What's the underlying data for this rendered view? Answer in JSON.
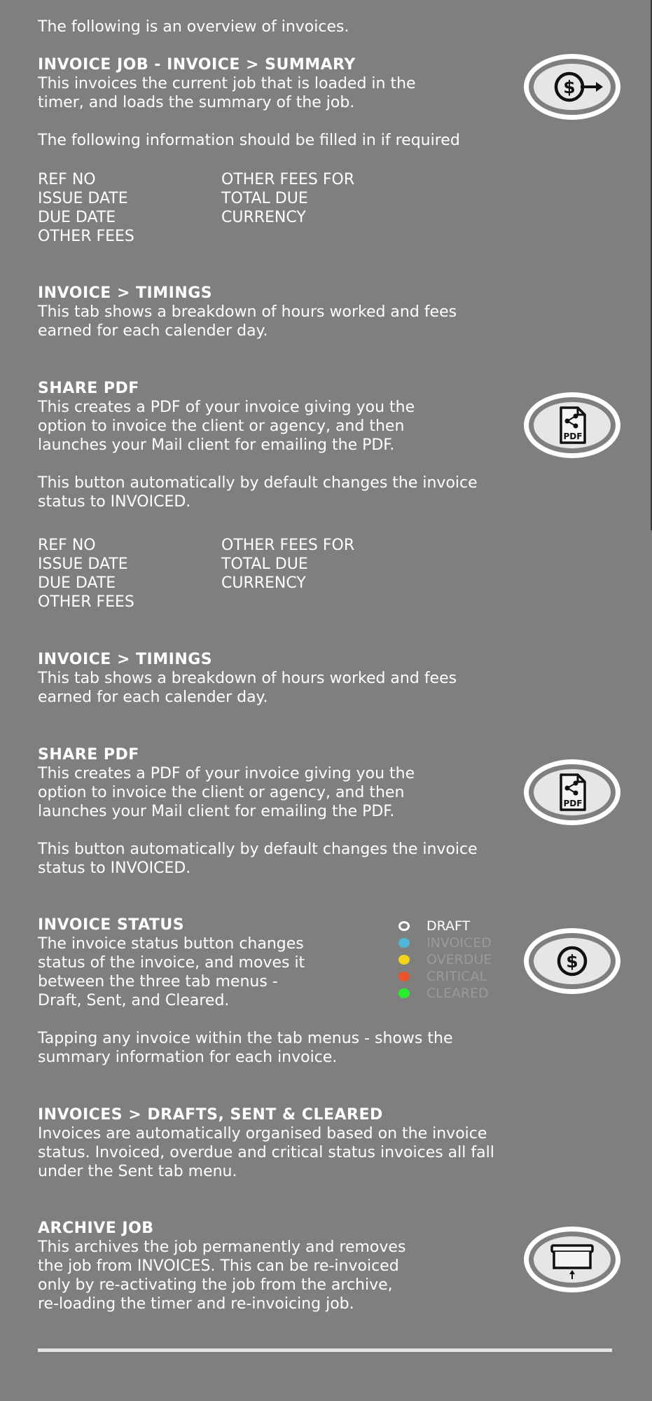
{
  "intro": "The following is an overview of invoices.",
  "sections": {
    "invoice_job": {
      "title": "INVOICE JOB - INVOICE > SUMMARY",
      "lines": [
        "This invoices the current job that is loaded in the",
        "timer, and loads the summary of the job."
      ],
      "note": "The following information should be filled in if required",
      "icon": "dollar-arrow-icon"
    },
    "fields": {
      "col1": [
        "REF NO",
        "ISSUE DATE",
        "DUE DATE",
        "OTHER FEES"
      ],
      "col2": [
        "OTHER FEES FOR",
        "TOTAL DUE",
        "CURRENCY"
      ]
    },
    "timings": {
      "title": "INVOICE > TIMINGS",
      "lines": [
        "This tab shows a breakdown of hours worked and fees",
        "earned for each calender day."
      ]
    },
    "share_pdf": {
      "title": "SHARE PDF",
      "lines": [
        "This creates a PDF of your invoice giving you the",
        "option to invoice the client or agency, and then",
        "launches your Mail client for emailing the PDF."
      ],
      "note_lines": [
        "This button automatically by default changes the invoice",
        "status to INVOICED."
      ],
      "icon": "pdf-share-icon",
      "icon_text": "PDF"
    },
    "invoice_status": {
      "title": "INVOICE STATUS",
      "lines": [
        "The invoice status button changes",
        "status of the invoice, and moves it",
        "between the three tab menus  -",
        "Draft, Sent, and Cleared."
      ],
      "note_lines": [
        "Tapping any invoice within the tab menus - shows the",
        "summary information for each invoice."
      ],
      "icon": "dollar-icon",
      "legend": [
        {
          "label": "DRAFT",
          "color": "#7f7f7f",
          "border": "#ffffff",
          "text_color": "#ffffff"
        },
        {
          "label": "INVOICED",
          "color": "#4fb8d6",
          "border": "#4fb8d6",
          "text_color": "#9a9a9a"
        },
        {
          "label": "OVERDUE",
          "color": "#f2d31b",
          "border": "#f2d31b",
          "text_color": "#9a9a9a"
        },
        {
          "label": "CRITICAL",
          "color": "#e8542e",
          "border": "#e8542e",
          "text_color": "#9a9a9a"
        },
        {
          "label": "CLEARED",
          "color": "#24f02b",
          "border": "#24f02b",
          "text_color": "#9a9a9a"
        }
      ]
    },
    "drafts": {
      "title": "INVOICES > DRAFTS, SENT & CLEARED",
      "lines": [
        "Invoices are automatically organised based on the invoice",
        "status. Invoiced, overdue and critical status invoices all fall",
        "under the Sent tab menu."
      ]
    },
    "archive": {
      "title": "ARCHIVE JOB",
      "lines": [
        "This archives the job permanently and removes",
        "the job from INVOICES. This can be re-invoiced",
        "only by re-activating the job from the archive,",
        "re-loading the timer and re-invoicing  job."
      ],
      "icon": "archive-box-icon"
    }
  },
  "colors": {
    "background": "#7f7f7f",
    "text": "#ffffff",
    "icon_fill": "#e6e6e6",
    "divider": "#e3e3e3"
  }
}
